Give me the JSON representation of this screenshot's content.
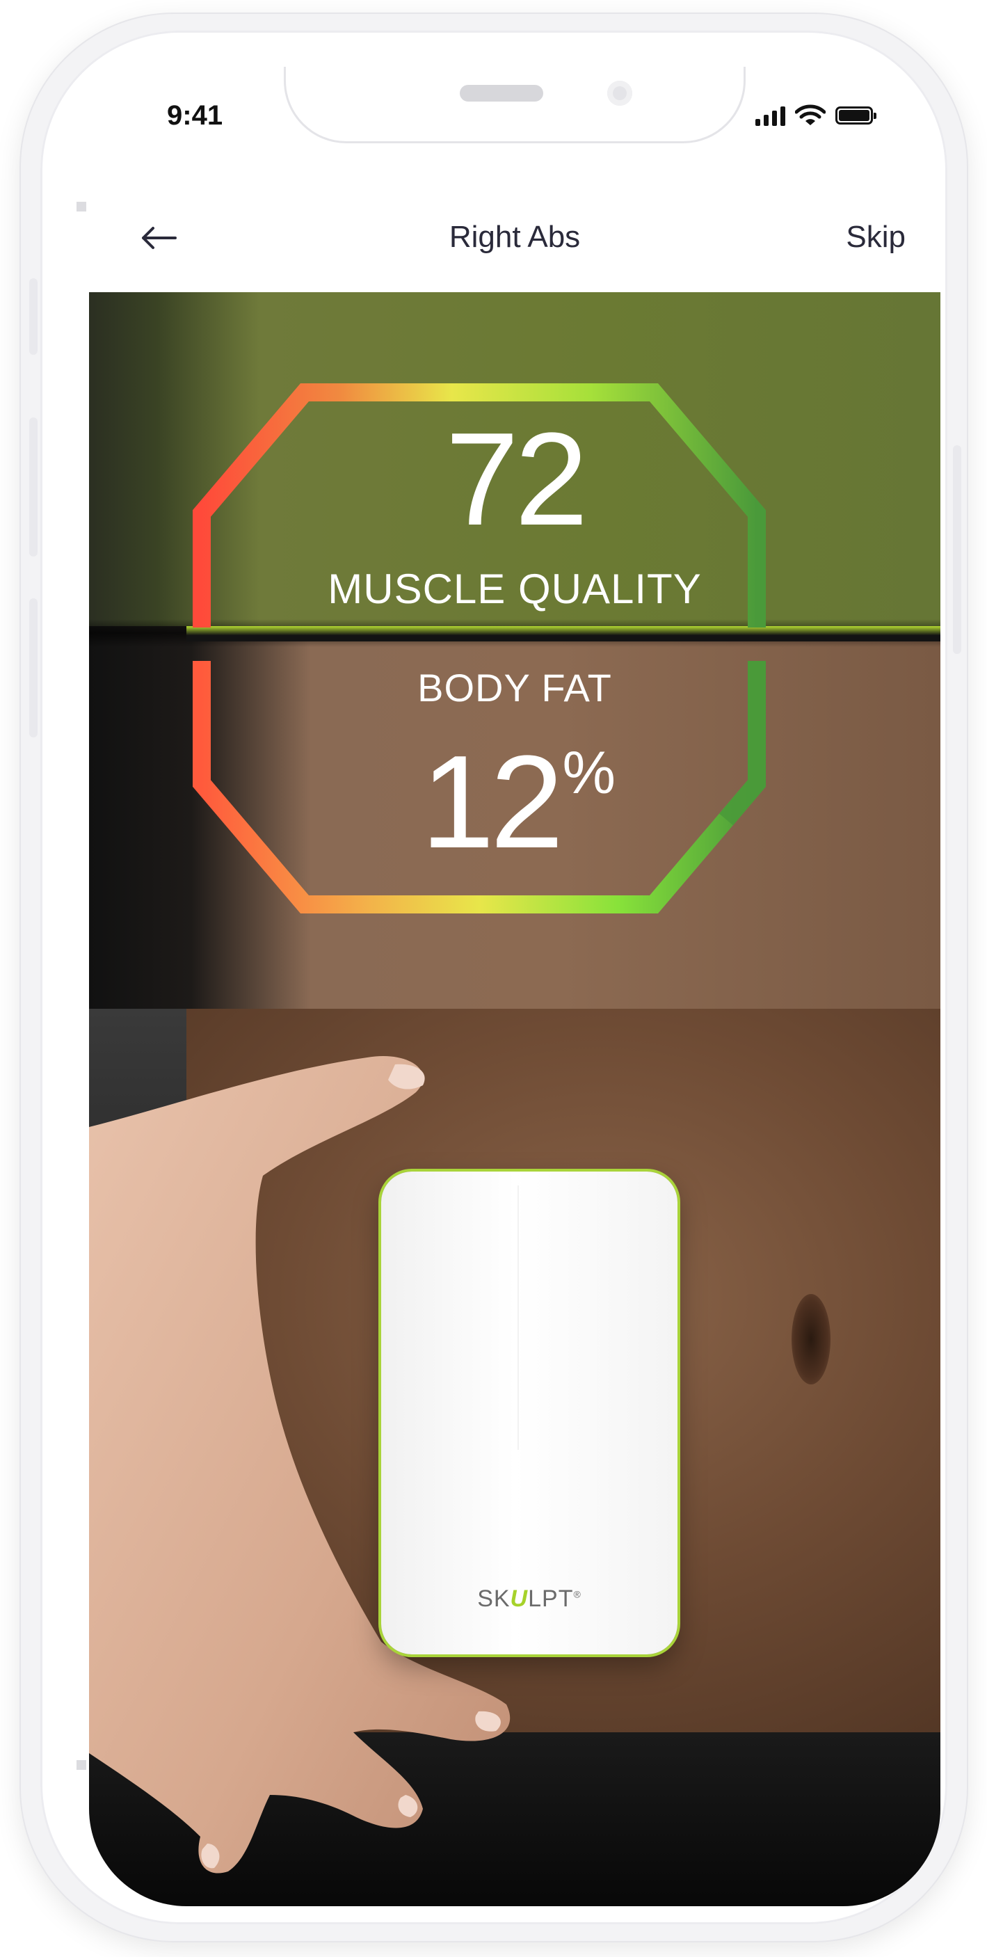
{
  "status_bar": {
    "time": "9:41",
    "icons": [
      "cellular-signal-icon",
      "wifi-icon",
      "battery-icon"
    ]
  },
  "nav": {
    "back_icon": "arrow-left-icon",
    "title": "Right Abs",
    "skip_label": "Skip"
  },
  "gauge": {
    "shape": "octagon",
    "muscle_quality": {
      "value": "72",
      "label": "MUSCLE QUALITY"
    },
    "body_fat": {
      "label": "BODY FAT",
      "value": "12",
      "unit": "%"
    },
    "colors": {
      "red": "#ff5a3c",
      "yellow": "#e8e64a",
      "green": "#88e23a",
      "dark_green": "#4a9a3a"
    }
  },
  "device": {
    "brand_prefix": "SK",
    "brand_accent": "U",
    "brand_suffix": "LPT",
    "trademark": "®",
    "accent_color": "#a6d22a"
  }
}
